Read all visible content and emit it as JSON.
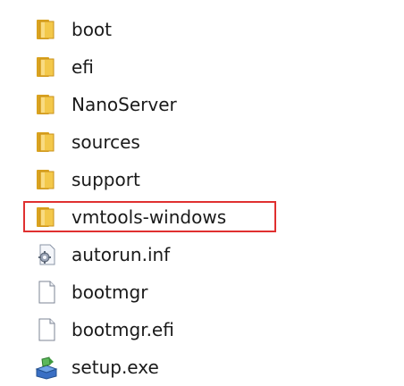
{
  "files": [
    {
      "name": "boot",
      "icon": "folder-icon"
    },
    {
      "name": "efi",
      "icon": "folder-icon"
    },
    {
      "name": "NanoServer",
      "icon": "folder-icon"
    },
    {
      "name": "sources",
      "icon": "folder-icon"
    },
    {
      "name": "support",
      "icon": "folder-icon"
    },
    {
      "name": "vmtools-windows",
      "icon": "folder-icon",
      "highlighted": true
    },
    {
      "name": "autorun.inf",
      "icon": "config-file-icon"
    },
    {
      "name": "bootmgr",
      "icon": "blank-file-icon"
    },
    {
      "name": "bootmgr.efi",
      "icon": "blank-file-icon"
    },
    {
      "name": "setup.exe",
      "icon": "setup-exe-icon"
    }
  ],
  "colors": {
    "highlight_border": "#e03030",
    "folder_front": "#f3c84a",
    "folder_back": "#d9a21f"
  }
}
